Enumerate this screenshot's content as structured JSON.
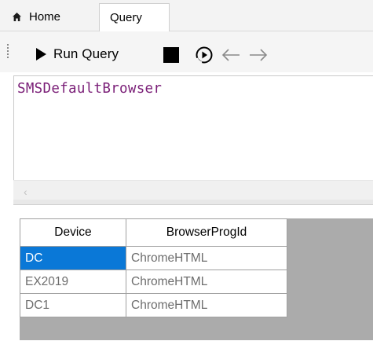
{
  "tabs": [
    {
      "label": "Home",
      "icon": "home-icon",
      "active": false
    },
    {
      "label": "Query",
      "active": true
    }
  ],
  "toolbar": {
    "run_label": "Run Query",
    "icons": [
      "play-icon",
      "stop-icon",
      "step-run-icon",
      "back-arrow-icon",
      "forward-arrow-icon"
    ]
  },
  "editor": {
    "text": "SMSDefaultBrowser",
    "text_color": "#7a1e77"
  },
  "results": {
    "columns": [
      "Device",
      "BrowserProgId"
    ],
    "rows": [
      {
        "device": "DC",
        "browser": "ChromeHTML",
        "selected": true
      },
      {
        "device": "EX2019",
        "browser": "ChromeHTML"
      },
      {
        "device": "DC1",
        "browser": "ChromeHTML"
      }
    ],
    "selection_color": "#0a78d7"
  }
}
